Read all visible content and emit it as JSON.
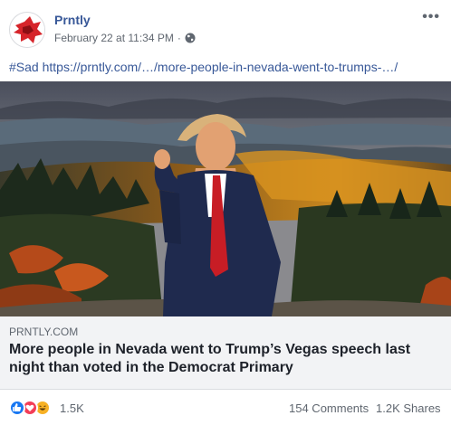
{
  "post": {
    "page_name": "Prntly",
    "timestamp": "February 22 at 11:34 PM",
    "separator": "·",
    "privacy_icon": "globe-icon",
    "more_icon": "more-options-icon",
    "more_glyph": "•••",
    "text": "#Sad https://prntly.com/…/more-people-in-nevada-went-to-trumps-…/"
  },
  "link_preview": {
    "domain": "PRNTLY.COM",
    "headline": "More people in Nevada went to Trump’s Vegas speech last night than voted in the Democrat Primary"
  },
  "engagement": {
    "reaction_icons": [
      "like-icon",
      "love-icon",
      "haha-icon"
    ],
    "reaction_count": "1.5K",
    "comments": "154 Comments",
    "shares": "1.2K Shares"
  },
  "colors": {
    "link_blue": "#385898",
    "like_blue": "#1877f2",
    "love_red": "#f33e58",
    "haha_yellow": "#f7b125"
  }
}
